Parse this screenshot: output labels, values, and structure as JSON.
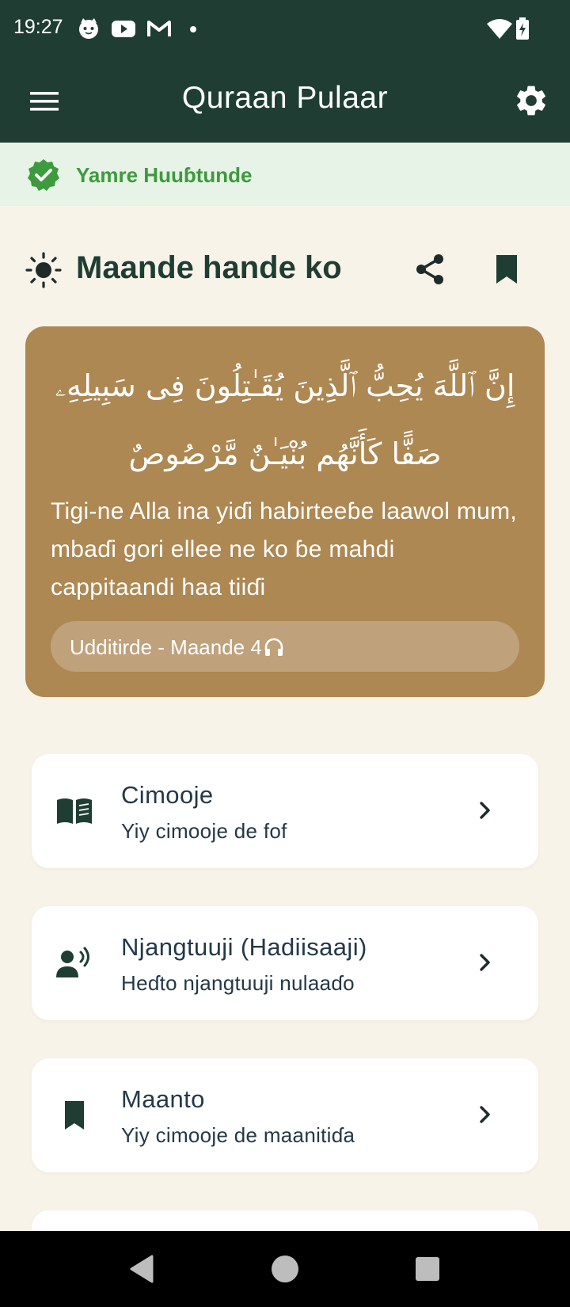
{
  "status_bar": {
    "time": "19:27"
  },
  "app_bar": {
    "title": "Quraan Pulaar"
  },
  "banner": {
    "text": "Yamre Huuɓtunde"
  },
  "verse": {
    "section_title": "Maande hande ko",
    "arabic": "إِنَّ ٱللَّهَ يُحِبُّ ٱلَّذِينَ يُقَـٰتِلُونَ فِى سَبِيلِهِۦ صَفًّا كَأَنَّهُم بُنْيَـٰنٌ مَّرْصُوصٌ",
    "translation": "Tigi-ne Alla ina yiɗi habirteeɓe laawol mum, mbaɗi gori ellee ne ko ɓe mahdi cappitaandi haa tiiɗi",
    "reference": "Udditirde - Maande 4"
  },
  "menu": [
    {
      "title": "Cimooje",
      "subtitle": "Yiy cimooje de fof",
      "icon": "book-icon"
    },
    {
      "title": "Njangtuuji (Hadiisaaji)",
      "subtitle": "Heɗto njangtuuji nulaaɗo",
      "icon": "speaker-person-icon"
    },
    {
      "title": "Maanto",
      "subtitle": "Yiy cimooje de maanitiɗa",
      "icon": "bookmark-icon"
    }
  ],
  "colors": {
    "primary_dark": "#1f3d33",
    "card_gold": "#ad8853",
    "success_green": "#3d9a3d",
    "background": "#f8f3e9"
  }
}
